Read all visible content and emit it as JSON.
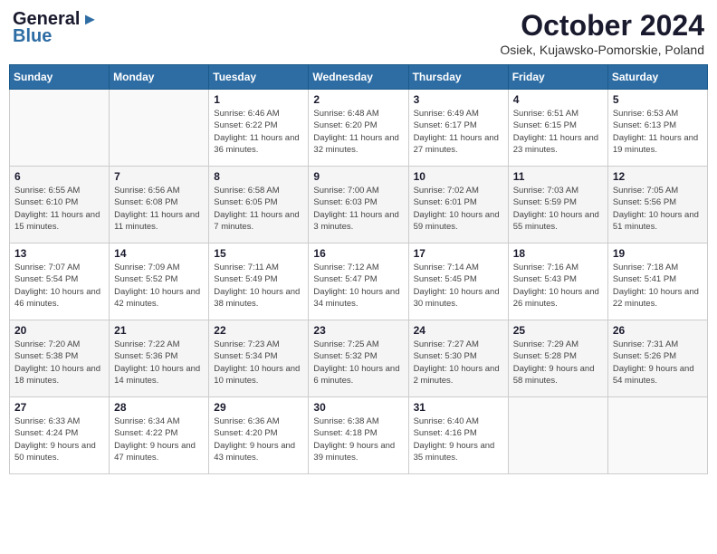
{
  "header": {
    "logo_line1": "General",
    "logo_line2": "Blue",
    "month_title": "October 2024",
    "location": "Osiek, Kujawsko-Pomorskie, Poland"
  },
  "weekdays": [
    "Sunday",
    "Monday",
    "Tuesday",
    "Wednesday",
    "Thursday",
    "Friday",
    "Saturday"
  ],
  "weeks": [
    [
      {
        "day": "",
        "info": ""
      },
      {
        "day": "",
        "info": ""
      },
      {
        "day": "1",
        "info": "Sunrise: 6:46 AM\nSunset: 6:22 PM\nDaylight: 11 hours and 36 minutes."
      },
      {
        "day": "2",
        "info": "Sunrise: 6:48 AM\nSunset: 6:20 PM\nDaylight: 11 hours and 32 minutes."
      },
      {
        "day": "3",
        "info": "Sunrise: 6:49 AM\nSunset: 6:17 PM\nDaylight: 11 hours and 27 minutes."
      },
      {
        "day": "4",
        "info": "Sunrise: 6:51 AM\nSunset: 6:15 PM\nDaylight: 11 hours and 23 minutes."
      },
      {
        "day": "5",
        "info": "Sunrise: 6:53 AM\nSunset: 6:13 PM\nDaylight: 11 hours and 19 minutes."
      }
    ],
    [
      {
        "day": "6",
        "info": "Sunrise: 6:55 AM\nSunset: 6:10 PM\nDaylight: 11 hours and 15 minutes."
      },
      {
        "day": "7",
        "info": "Sunrise: 6:56 AM\nSunset: 6:08 PM\nDaylight: 11 hours and 11 minutes."
      },
      {
        "day": "8",
        "info": "Sunrise: 6:58 AM\nSunset: 6:05 PM\nDaylight: 11 hours and 7 minutes."
      },
      {
        "day": "9",
        "info": "Sunrise: 7:00 AM\nSunset: 6:03 PM\nDaylight: 11 hours and 3 minutes."
      },
      {
        "day": "10",
        "info": "Sunrise: 7:02 AM\nSunset: 6:01 PM\nDaylight: 10 hours and 59 minutes."
      },
      {
        "day": "11",
        "info": "Sunrise: 7:03 AM\nSunset: 5:59 PM\nDaylight: 10 hours and 55 minutes."
      },
      {
        "day": "12",
        "info": "Sunrise: 7:05 AM\nSunset: 5:56 PM\nDaylight: 10 hours and 51 minutes."
      }
    ],
    [
      {
        "day": "13",
        "info": "Sunrise: 7:07 AM\nSunset: 5:54 PM\nDaylight: 10 hours and 46 minutes."
      },
      {
        "day": "14",
        "info": "Sunrise: 7:09 AM\nSunset: 5:52 PM\nDaylight: 10 hours and 42 minutes."
      },
      {
        "day": "15",
        "info": "Sunrise: 7:11 AM\nSunset: 5:49 PM\nDaylight: 10 hours and 38 minutes."
      },
      {
        "day": "16",
        "info": "Sunrise: 7:12 AM\nSunset: 5:47 PM\nDaylight: 10 hours and 34 minutes."
      },
      {
        "day": "17",
        "info": "Sunrise: 7:14 AM\nSunset: 5:45 PM\nDaylight: 10 hours and 30 minutes."
      },
      {
        "day": "18",
        "info": "Sunrise: 7:16 AM\nSunset: 5:43 PM\nDaylight: 10 hours and 26 minutes."
      },
      {
        "day": "19",
        "info": "Sunrise: 7:18 AM\nSunset: 5:41 PM\nDaylight: 10 hours and 22 minutes."
      }
    ],
    [
      {
        "day": "20",
        "info": "Sunrise: 7:20 AM\nSunset: 5:38 PM\nDaylight: 10 hours and 18 minutes."
      },
      {
        "day": "21",
        "info": "Sunrise: 7:22 AM\nSunset: 5:36 PM\nDaylight: 10 hours and 14 minutes."
      },
      {
        "day": "22",
        "info": "Sunrise: 7:23 AM\nSunset: 5:34 PM\nDaylight: 10 hours and 10 minutes."
      },
      {
        "day": "23",
        "info": "Sunrise: 7:25 AM\nSunset: 5:32 PM\nDaylight: 10 hours and 6 minutes."
      },
      {
        "day": "24",
        "info": "Sunrise: 7:27 AM\nSunset: 5:30 PM\nDaylight: 10 hours and 2 minutes."
      },
      {
        "day": "25",
        "info": "Sunrise: 7:29 AM\nSunset: 5:28 PM\nDaylight: 9 hours and 58 minutes."
      },
      {
        "day": "26",
        "info": "Sunrise: 7:31 AM\nSunset: 5:26 PM\nDaylight: 9 hours and 54 minutes."
      }
    ],
    [
      {
        "day": "27",
        "info": "Sunrise: 6:33 AM\nSunset: 4:24 PM\nDaylight: 9 hours and 50 minutes."
      },
      {
        "day": "28",
        "info": "Sunrise: 6:34 AM\nSunset: 4:22 PM\nDaylight: 9 hours and 47 minutes."
      },
      {
        "day": "29",
        "info": "Sunrise: 6:36 AM\nSunset: 4:20 PM\nDaylight: 9 hours and 43 minutes."
      },
      {
        "day": "30",
        "info": "Sunrise: 6:38 AM\nSunset: 4:18 PM\nDaylight: 9 hours and 39 minutes."
      },
      {
        "day": "31",
        "info": "Sunrise: 6:40 AM\nSunset: 4:16 PM\nDaylight: 9 hours and 35 minutes."
      },
      {
        "day": "",
        "info": ""
      },
      {
        "day": "",
        "info": ""
      }
    ]
  ]
}
